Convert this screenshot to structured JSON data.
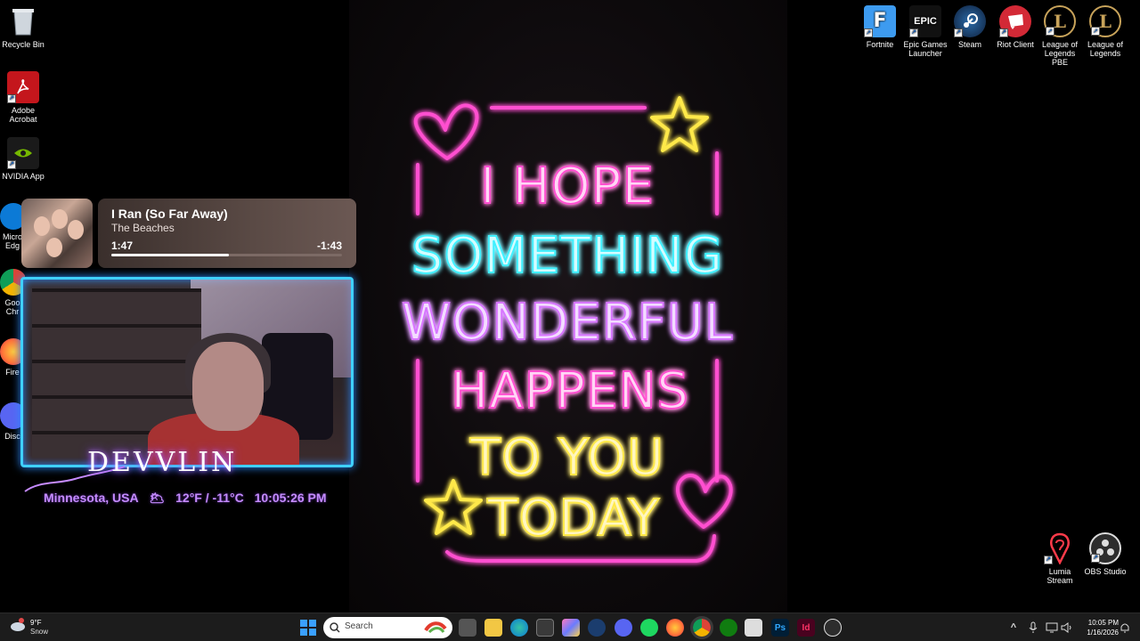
{
  "desktop": {
    "left_icons": [
      {
        "label": "Recycle Bin",
        "icon": "recycle-bin-icon"
      },
      {
        "label": "Adobe Acrobat",
        "icon": "acrobat-icon"
      },
      {
        "label": "NVIDIA App",
        "icon": "nvidia-icon"
      },
      {
        "label": "Micro Edg",
        "icon": "edge-icon"
      },
      {
        "label": "Goo Chr",
        "icon": "chrome-icon"
      },
      {
        "label": "Fire",
        "icon": "firefox-icon"
      },
      {
        "label": "Disc",
        "icon": "discord-icon"
      }
    ],
    "top_right_icons": [
      {
        "label": "Fortnite",
        "glyph": "F",
        "icon": "fortnite-icon",
        "color": "#3d9bf0"
      },
      {
        "label": "Epic Games Launcher",
        "glyph": "EPIC",
        "icon": "epic-games-icon",
        "color": "#111111"
      },
      {
        "label": "Steam",
        "glyph": "S",
        "icon": "steam-icon",
        "color": "#1b3d6e"
      },
      {
        "label": "Riot Client",
        "glyph": "R",
        "icon": "riot-client-icon",
        "color": "#d32936"
      },
      {
        "label": "League of Legends PBE",
        "glyph": "L",
        "icon": "league-pbe-icon",
        "color": "#c8a35a"
      },
      {
        "label": "League of Legends",
        "glyph": "L",
        "icon": "league-icon",
        "color": "#c8a35a"
      }
    ],
    "bottom_right_icons": [
      {
        "label": "Lumia Stream",
        "icon": "lumia-stream-icon"
      },
      {
        "label": "OBS Studio",
        "icon": "obs-studio-icon"
      }
    ]
  },
  "wallpaper": {
    "lines": [
      "I HOPE",
      "SOMETHING",
      "WONDERFUL",
      "HAPPENS",
      "TO YOU",
      "TODAY"
    ],
    "colors": {
      "pink": "#ff4fd0",
      "cyan": "#3ff0ff",
      "violet": "#d776ff",
      "yellow": "#ffe94a"
    }
  },
  "music_widget": {
    "title": "I Ran (So Far Away)",
    "artist": "The Beaches",
    "elapsed": "1:47",
    "remaining": "-1:43",
    "progress": 0.51
  },
  "stream_overlay": {
    "name": "DEVVLIN",
    "location": "Minnesota, USA",
    "weather_icon": "🌥",
    "temperature": "12°F / -11°C",
    "time": "10:05:26 PM"
  },
  "taskbar": {
    "weather_temp": "9°F",
    "weather_cond": "Snow",
    "search_placeholder": "Search",
    "apps": [
      "start-button",
      "search-box",
      "task-view",
      "file-explorer",
      "edge",
      "store",
      "copilot",
      "steam",
      "discord",
      "spotify",
      "firefox",
      "chrome",
      "xbox",
      "snipping-tool",
      "photoshop",
      "indesign",
      "obs"
    ],
    "clock_time": "10:05 PM",
    "clock_date": "1/16/2026"
  }
}
